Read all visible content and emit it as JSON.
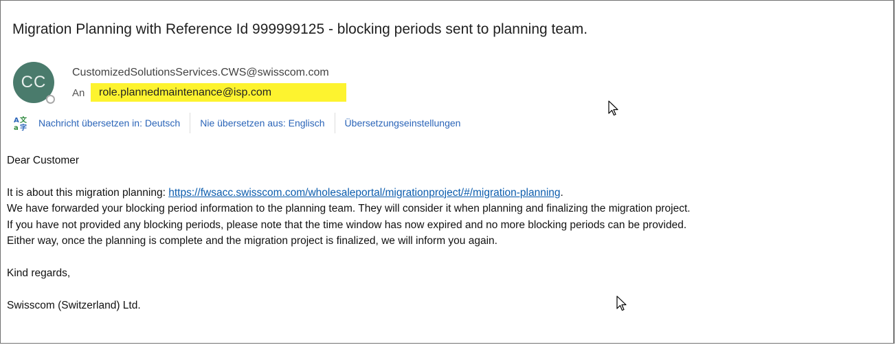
{
  "email": {
    "subject": "Migration Planning with Reference Id 999999125 - blocking periods sent to planning team.",
    "avatar_initials": "CC",
    "sender": "CustomizedSolutionsServices.CWS@swisscom.com",
    "to_label": "An",
    "recipient": "role.plannedmaintenance@isp.com"
  },
  "translation_bar": {
    "icon": "translate-icon",
    "translate_link": "Nachricht übersetzen in: Deutsch",
    "never_translate_link": "Nie übersetzen aus: Englisch",
    "settings_link": "Übersetzungseinstellungen"
  },
  "body": {
    "greeting": "Dear Customer",
    "line1_prefix": "It is about this migration planning: ",
    "line1_link": "https://fwsacc.swisscom.com/wholesaleportal/migrationproject/#/migration-planning",
    "line1_suffix": ".",
    "line2": "We have forwarded your blocking period information to the planning team. They will consider it when planning and finalizing the migration project.",
    "line3": "If you have not provided any blocking periods, please note that the time window has now expired and no more blocking periods can be provided.",
    "line4": "Either way, once the planning is complete and the migration project is finalized, we will inform you again.",
    "closing": "Kind regards,",
    "signature": "Swisscom (Switzerland) Ltd."
  },
  "colors": {
    "link": "#0b5cad",
    "toolbar_link": "#2a64b8",
    "highlight": "#fdf32f",
    "avatar": "#4a7b6c"
  }
}
